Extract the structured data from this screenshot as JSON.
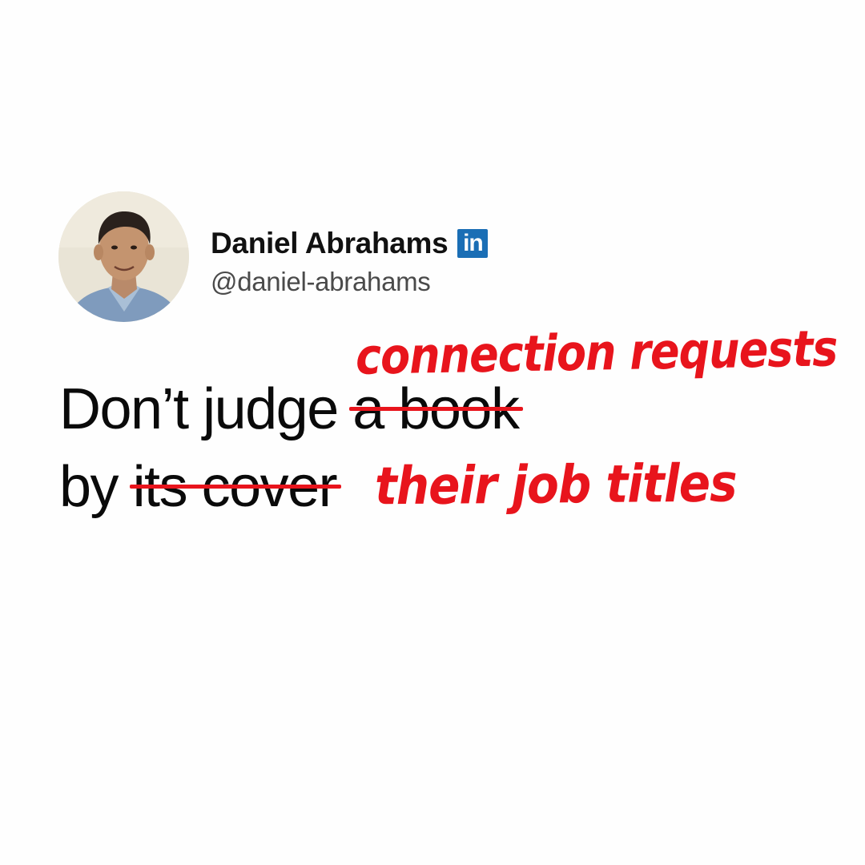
{
  "profile": {
    "name": "Daniel Abrahams",
    "handle": "@daniel-abrahams",
    "badge_icon": "linkedin-icon",
    "badge_text": "in",
    "badge_color": "#1a6eb5"
  },
  "quote": {
    "line1_plain": "Don’t judge",
    "line1_struck": "a book",
    "line2_plain": "by",
    "line2_struck": "its cover",
    "annotation_top": "connection requests",
    "annotation_bottom": "their job titles"
  },
  "colors": {
    "text": "#0a0a0a",
    "handle": "#4a4a4a",
    "annotation": "#e8141c",
    "background": "#fefefe"
  }
}
